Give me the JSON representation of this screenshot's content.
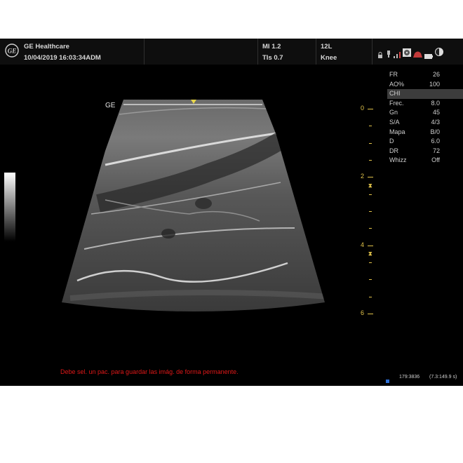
{
  "header": {
    "manufacturer": "GE Healthcare",
    "datetime": "10/04/2019 16:03:34ADM",
    "mi": "MI 1.2",
    "tis": "TIs 0.7",
    "probe": "12L",
    "preset": "Knee",
    "status_icons": [
      "lock-icon",
      "probe-icon",
      "network-icon",
      "dvd-icon",
      "printer-icon",
      "battery-icon",
      "contrast-icon"
    ]
  },
  "params": [
    {
      "label": "FR",
      "value": "26"
    },
    {
      "label": "AO%",
      "value": "100"
    },
    {
      "label": "CHI",
      "value": ""
    },
    {
      "label": "Frec.",
      "value": "8.0"
    },
    {
      "label": "Gn",
      "value": "45"
    },
    {
      "label": "S/A",
      "value": "4/3"
    },
    {
      "label": "Mapa",
      "value": "B/0"
    },
    {
      "label": "D",
      "value": "6.0"
    },
    {
      "label": "DR",
      "value": "72"
    },
    {
      "label": "Whizz",
      "value": "Off"
    }
  ],
  "image": {
    "orientation_marker": "GE"
  },
  "depth_scale": {
    "labels": [
      "0",
      "2",
      "4",
      "6"
    ],
    "unit_max_cm": 6,
    "focal_zones_cm": [
      2.25,
      4.25
    ]
  },
  "status": {
    "warning": "Debe sel. un pac. para guardar las imág. de forma permanente.",
    "cine_frame": "179:3836",
    "cine_time": "(7.3:149.9 s)"
  },
  "colors": {
    "screen_bg": "#000000",
    "header_bg": "#0e0e0e",
    "scale_yellow": "#e2c34a",
    "warning_red": "#e01818",
    "cine_blue": "#2d6fd6",
    "highlight_row": "#3c3c3c"
  }
}
